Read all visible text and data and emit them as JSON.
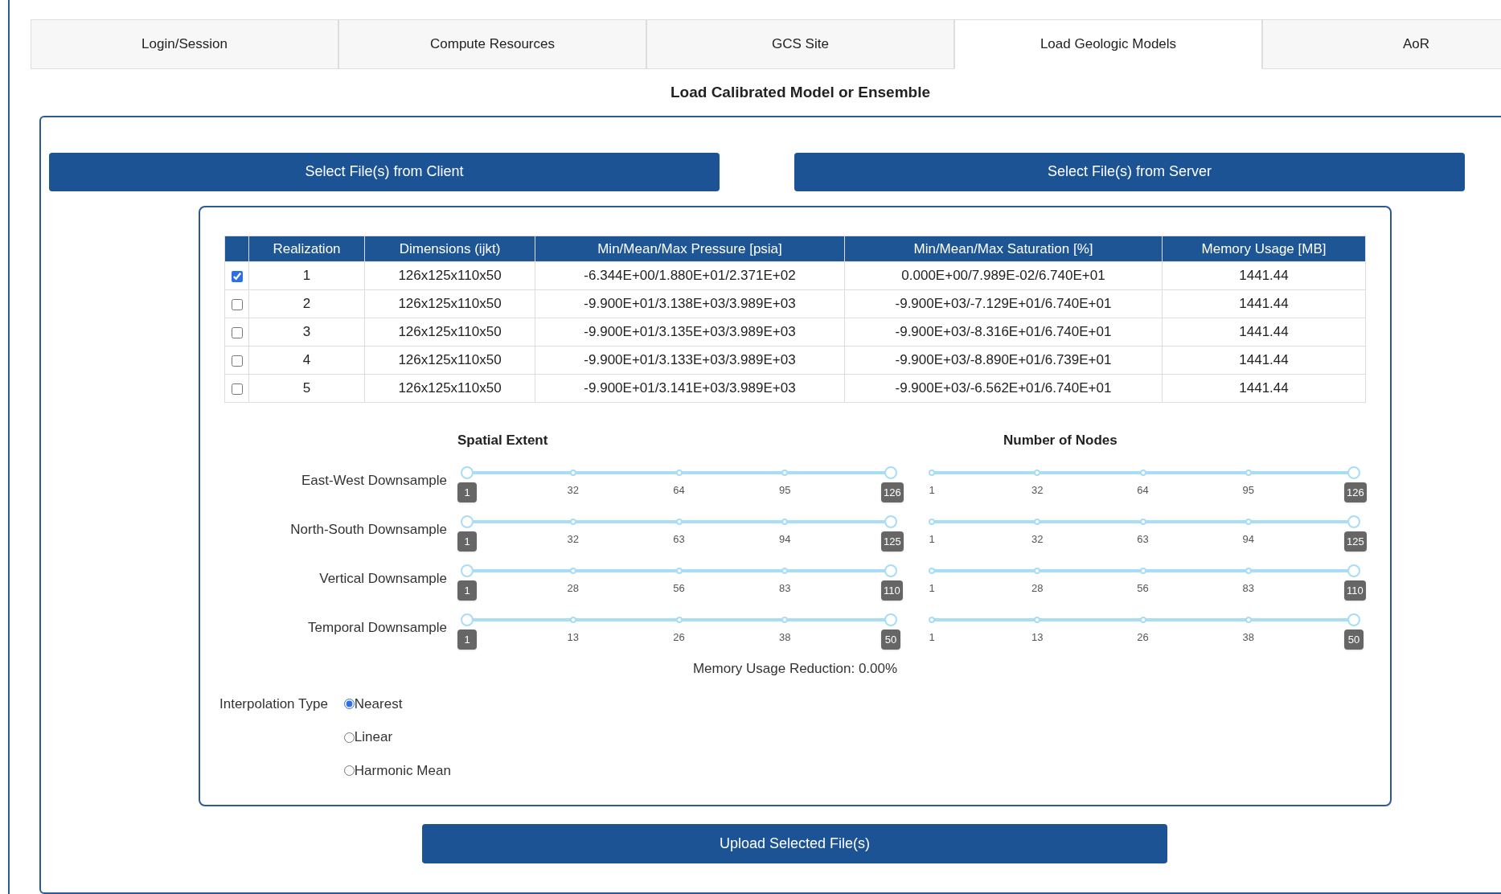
{
  "tabs": [
    {
      "label": "Login/Session",
      "selected": false
    },
    {
      "label": "Compute Resources",
      "selected": false
    },
    {
      "label": "GCS Site",
      "selected": false
    },
    {
      "label": "Load Geologic Models",
      "selected": true
    },
    {
      "label": "AoR",
      "selected": false
    }
  ],
  "title": "Load Calibrated Model or Ensemble",
  "source_buttons": [
    "Select File(s) from Client",
    "Select File(s) from Server"
  ],
  "table": {
    "columns": [
      "Realization",
      "Dimensions (ijkt)",
      "Min/Mean/Max Pressure [psia]",
      "Min/Mean/Max Saturation [%]",
      "Memory Usage [MB]"
    ],
    "rows": [
      {
        "checked": true,
        "cells": [
          "1",
          "126x125x110x50",
          "-6.344E+00/1.880E+01/2.371E+02",
          "0.000E+00/7.989E-02/6.740E+01",
          "1441.44"
        ]
      },
      {
        "checked": false,
        "cells": [
          "2",
          "126x125x110x50",
          "-9.900E+01/3.138E+03/3.989E+03",
          "-9.900E+03/-7.129E+01/6.740E+01",
          "1441.44"
        ]
      },
      {
        "checked": false,
        "cells": [
          "3",
          "126x125x110x50",
          "-9.900E+01/3.135E+03/3.989E+03",
          "-9.900E+03/-8.316E+01/6.740E+01",
          "1441.44"
        ]
      },
      {
        "checked": false,
        "cells": [
          "4",
          "126x125x110x50",
          "-9.900E+01/3.133E+03/3.989E+03",
          "-9.900E+03/-8.890E+01/6.739E+01",
          "1441.44"
        ]
      },
      {
        "checked": false,
        "cells": [
          "5",
          "126x125x110x50",
          "-9.900E+01/3.141E+03/3.989E+03",
          "-9.900E+03/-6.562E+01/6.740E+01",
          "1441.44"
        ]
      }
    ]
  },
  "downsampling": {
    "headings": [
      "Spatial Extent",
      "Number of Nodes"
    ],
    "rows": [
      {
        "label": "East-West Downsample",
        "sliders": [
          {
            "ticks": [
              {
                "label": "1",
                "badge": true
              },
              {
                "label": "32",
                "badge": false
              },
              {
                "label": "64",
                "badge": false
              },
              {
                "label": "95",
                "badge": false
              },
              {
                "label": "126",
                "badge": true
              }
            ],
            "thumbs": [
              {
                "level": 0
              },
              {
                "level": 1
              }
            ]
          },
          {
            "ticks": [
              {
                "label": "1",
                "badge": false
              },
              {
                "label": "32",
                "badge": false
              },
              {
                "label": "64",
                "badge": false
              },
              {
                "label": "95",
                "badge": false
              },
              {
                "label": "126",
                "badge": true
              }
            ],
            "thumbs": [
              {
                "level": 1
              }
            ]
          }
        ]
      },
      {
        "label": "North-South Downsample",
        "sliders": [
          {
            "ticks": [
              {
                "label": "1",
                "badge": true
              },
              {
                "label": "32",
                "badge": false
              },
              {
                "label": "63",
                "badge": false
              },
              {
                "label": "94",
                "badge": false
              },
              {
                "label": "125",
                "badge": true
              }
            ],
            "thumbs": [
              {
                "level": 0
              },
              {
                "level": 1
              }
            ]
          },
          {
            "ticks": [
              {
                "label": "1",
                "badge": false
              },
              {
                "label": "32",
                "badge": false
              },
              {
                "label": "63",
                "badge": false
              },
              {
                "label": "94",
                "badge": false
              },
              {
                "label": "125",
                "badge": true
              }
            ],
            "thumbs": [
              {
                "level": 1
              }
            ]
          }
        ]
      },
      {
        "label": "Vertical Downsample",
        "sliders": [
          {
            "ticks": [
              {
                "label": "1",
                "badge": true
              },
              {
                "label": "28",
                "badge": false
              },
              {
                "label": "56",
                "badge": false
              },
              {
                "label": "83",
                "badge": false
              },
              {
                "label": "110",
                "badge": true
              }
            ],
            "thumbs": [
              {
                "level": 0
              },
              {
                "level": 1
              }
            ]
          },
          {
            "ticks": [
              {
                "label": "1",
                "badge": false
              },
              {
                "label": "28",
                "badge": false
              },
              {
                "label": "56",
                "badge": false
              },
              {
                "label": "83",
                "badge": false
              },
              {
                "label": "110",
                "badge": true
              }
            ],
            "thumbs": [
              {
                "level": 1
              }
            ]
          }
        ]
      },
      {
        "label": "Temporal Downsample",
        "sliders": [
          {
            "ticks": [
              {
                "label": "1",
                "badge": true
              },
              {
                "label": "13",
                "badge": false
              },
              {
                "label": "26",
                "badge": false
              },
              {
                "label": "38",
                "badge": false
              },
              {
                "label": "50",
                "badge": true
              }
            ],
            "thumbs": [
              {
                "level": 0
              },
              {
                "level": 1
              }
            ]
          },
          {
            "ticks": [
              {
                "label": "1",
                "badge": false
              },
              {
                "label": "13",
                "badge": false
              },
              {
                "label": "26",
                "badge": false
              },
              {
                "label": "38",
                "badge": false
              },
              {
                "label": "50",
                "badge": true
              }
            ],
            "thumbs": [
              {
                "level": 1
              }
            ]
          }
        ]
      }
    ]
  },
  "memory_reduction": "Memory Usage Reduction: 0.00%",
  "interpolation": {
    "label": "Interpolation Type",
    "options": [
      {
        "label": "Nearest",
        "selected": true
      },
      {
        "label": "Linear",
        "selected": false
      },
      {
        "label": "Harmonic Mean",
        "selected": false
      }
    ]
  },
  "upload_button": "Upload Selected File(s)"
}
